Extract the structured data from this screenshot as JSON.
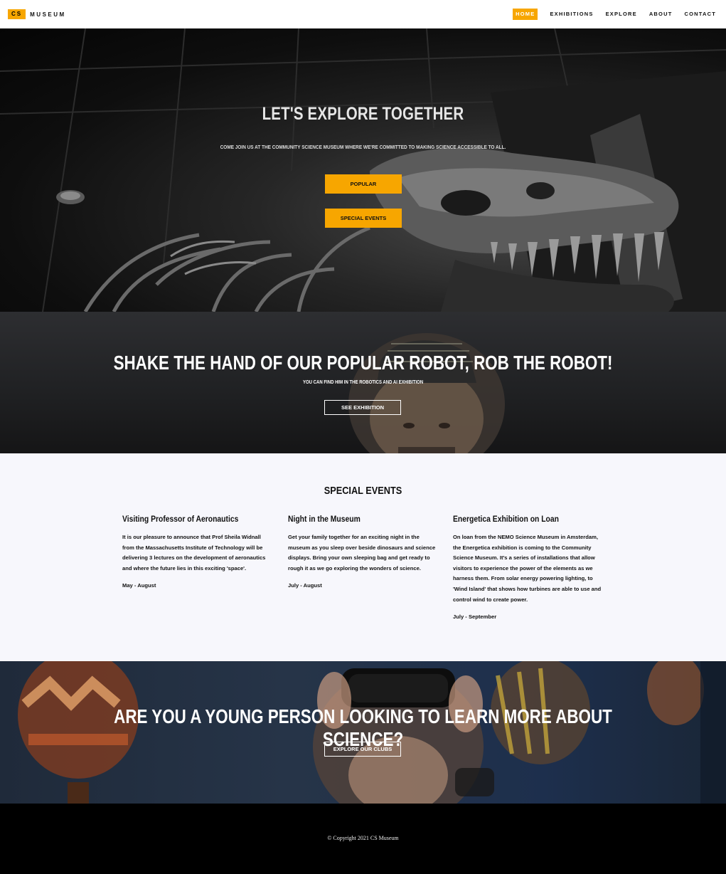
{
  "nav": {
    "logo_badge": "CS",
    "logo_text": "MUSEUM",
    "links": [
      "HOME",
      "EXHIBITIONS",
      "EXPLORE",
      "ABOUT",
      "CONTACT"
    ]
  },
  "hero": {
    "title": "LET'S EXPLORE TOGETHER",
    "subtitle": "COME JOIN US AT THE COMMUNITY SCIENCE MUSEUM WHERE WE'RE COMMITTED TO MAKING SCIENCE ACCESSIBLE TO ALL.",
    "buttons": [
      "POPULAR",
      "SPECIAL EVENTS"
    ]
  },
  "robot": {
    "title": "SHAKE THE HAND OF OUR POPULAR ROBOT, ROB THE ROBOT!",
    "subtitle": "YOU CAN FIND HIM IN THE ROBOTICS AND AI EXHIBITION",
    "button": "SEE EXHIBITION"
  },
  "events": {
    "title": "SPECIAL EVENTS",
    "items": [
      {
        "title": "Visiting Professor of Aeronautics",
        "body": "It is our pleasure to announce that Prof Sheila Widnall from the Massachusetts Institute of Technology will be delivering 3 lectures on the development of aeronautics and where the future lies in this exciting 'space'.",
        "date": "May - August"
      },
      {
        "title": "Night in the Museum",
        "body": "Get your family together for an exciting night in the museum as you sleep over beside dinosaurs and science displays. Bring your own sleeping bag and get ready to rough it as we go exploring the wonders of science.",
        "date": "July - August"
      },
      {
        "title": "Energetica Exhibition on Loan",
        "body": "On loan from the NEMO Science Museum in Amsterdam, the Energetica exhibition is coming to the Community Science Museum. It's a series of installations that allow visitors to experience the power of the elements as we harness them. From solar energy powering lighting, to 'Wind Island' that shows how turbines are able to use and control wind to create power.",
        "date": "July - September"
      }
    ]
  },
  "youth": {
    "title": "ARE YOU A YOUNG PERSON LOOKING TO LEARN MORE ABOUT SCIENCE?",
    "button": "EXPLORE OUR CLUBS"
  },
  "footer": {
    "copyright": "© Copyright 2021 CS Museum"
  },
  "colors": {
    "accent": "#f7a600",
    "events_bg": "#f7f7fc",
    "footer_bg": "#000000"
  }
}
